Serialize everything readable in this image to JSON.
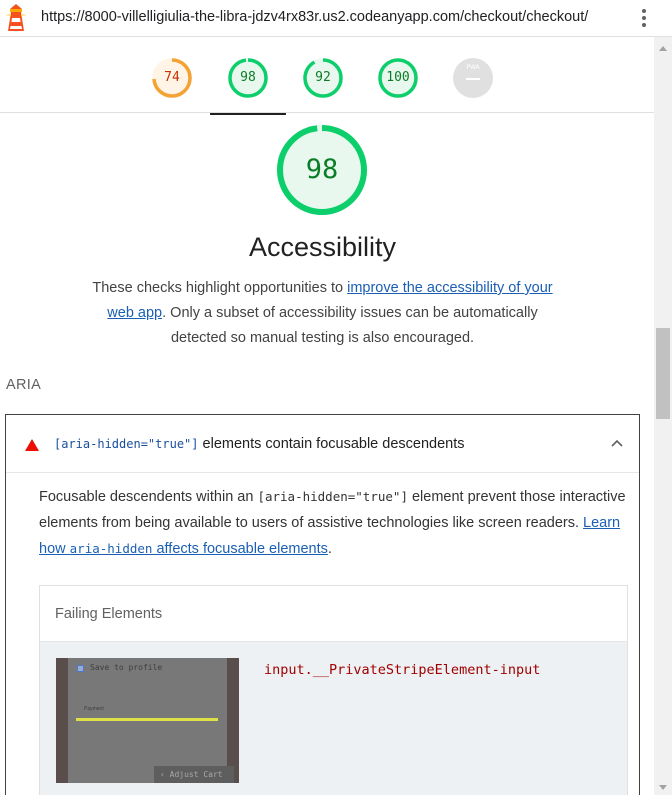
{
  "browser": {
    "url": "https://8000-villelligiulia-the-libra-jdzv4rx83r.us2.codeanyapp.com/checkout/checkout/",
    "logo_icon": "lighthouse-icon",
    "menu_icon": "kebab-menu-icon"
  },
  "gauges": [
    {
      "label": "74",
      "score": 0.74,
      "color": "#f4a233",
      "fill": "#fff4e6",
      "active": false
    },
    {
      "label": "98",
      "score": 0.98,
      "color": "#0cce6b",
      "fill": "#e8f8ee",
      "active": true
    },
    {
      "label": "92",
      "score": 0.92,
      "color": "#0cce6b",
      "fill": "#e8f8ee",
      "active": false
    },
    {
      "label": "100",
      "score": 1.0,
      "color": "#0cce6b",
      "fill": "#e8f8ee",
      "active": false
    },
    {
      "label": "PWA",
      "score": 0,
      "color": "#e0e0e0",
      "fill": "#e0e0e0",
      "active": false
    }
  ],
  "category": {
    "score": "98",
    "score_value": 0.98,
    "title": "Accessibility",
    "desc_before": "These checks highlight opportunities to ",
    "desc_link": "improve the accessibility of your web app",
    "desc_after": ". Only a subset of accessibility issues can be automatically detected so manual testing is also encouraged."
  },
  "group_title": "ARIA",
  "audit": {
    "status_icon": "fail-triangle-icon",
    "title_code": "[aria-hidden=\"true\"]",
    "title_text": " elements contain focusable descendents",
    "desc_part1": "Focusable descendents within an ",
    "desc_code": "[aria-hidden=\"true\"]",
    "desc_part2": " element prevent those interactive elements from being available to users of assistive technologies like screen readers. ",
    "link_part1": "Learn how ",
    "link_code": "aria-hidden",
    "link_part2": " affects focusable elements",
    "desc_end": ".",
    "details_header": "Failing Elements",
    "node_selector": "input.__PrivateStripeElement-input",
    "thumb_save": "Save to profile",
    "thumb_btn": "‹ Adjust Cart",
    "thumb_pay": "Payment"
  },
  "colors": {
    "pass": "#0cce6b",
    "average": "#f4a233",
    "fail": "#eb0f00",
    "link": "#1a5fb4"
  }
}
